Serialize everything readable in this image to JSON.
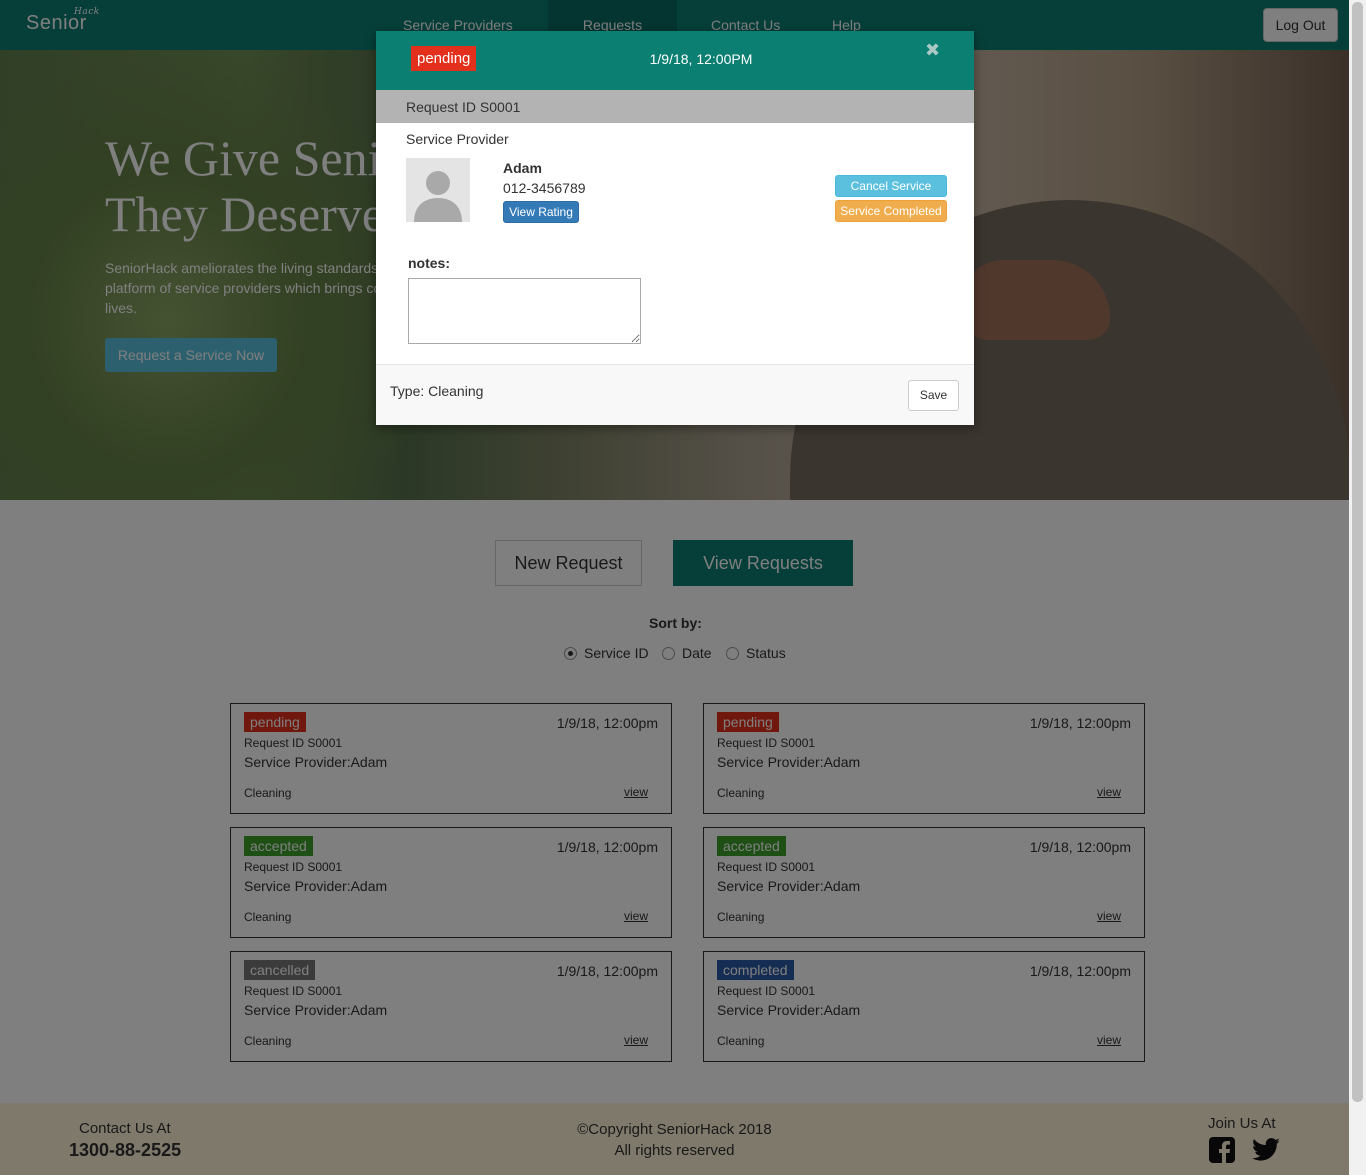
{
  "nav": {
    "logo": "Senior",
    "logo_super": "Hack",
    "links": [
      "Service Providers",
      "Requests",
      "Contact Us",
      "Help"
    ],
    "logout": "Log Out"
  },
  "hero": {
    "title": "We Give Seniors\nThey Deserve",
    "text": "SeniorHack ameliorates the living standards of the elderly by providing a platform of service providers which brings convenience and comfort in their lives.",
    "cta": "Request a Service Now"
  },
  "main": {
    "new_request": "New Request",
    "view_requests": "View Requests",
    "sort_label": "Sort by:",
    "sort_options": [
      "Service ID",
      "Date",
      "Status"
    ],
    "sort_selected": "Service ID"
  },
  "cards": [
    {
      "status": "pending",
      "color": "#e2301c",
      "date": "1/9/18, 12:00pm",
      "request_id": "Request ID S0001",
      "provider": "Service Provider:Adam",
      "type": "Cleaning",
      "link": "view"
    },
    {
      "status": "pending",
      "color": "#e2301c",
      "date": "1/9/18, 12:00pm",
      "request_id": "Request ID S0001",
      "provider": "Service Provider:Adam",
      "type": "Cleaning",
      "link": "view"
    },
    {
      "status": "accepted",
      "color": "#3c9e2a",
      "date": "1/9/18, 12:00pm",
      "request_id": "Request ID S0001",
      "provider": "Service Provider:Adam",
      "type": "Cleaning",
      "link": "view"
    },
    {
      "status": "accepted",
      "color": "#3c9e2a",
      "date": "1/9/18, 12:00pm",
      "request_id": "Request ID S0001",
      "provider": "Service Provider:Adam",
      "type": "Cleaning",
      "link": "view"
    },
    {
      "status": "cancelled",
      "color": "#777777",
      "date": "1/9/18, 12:00pm",
      "request_id": "Request ID S0001",
      "provider": "Service Provider:Adam",
      "type": "Cleaning",
      "link": "view"
    },
    {
      "status": "completed",
      "color": "#2d5aa6",
      "date": "1/9/18, 12:00pm",
      "request_id": "Request ID S0001",
      "provider": "Service Provider:Adam",
      "type": "Cleaning",
      "link": "view"
    }
  ],
  "footer": {
    "contact_label": "Contact Us At",
    "phone": "1300-88-2525",
    "copyright": "©Copyright SeniorHack 2018",
    "rights": "All rights reserved",
    "join": "Join Us At",
    "icons": [
      "facebook-icon",
      "twitter-icon"
    ]
  },
  "modal": {
    "status": "pending",
    "status_color": "#e2301c",
    "date": "1/9/18, 12:00PM",
    "close_icon": "close-icon",
    "request_id": "Request ID S0001",
    "section_title": "Service Provider",
    "provider_name": "Adam",
    "provider_phone": "012-3456789",
    "view_rating": "View Rating",
    "cancel_service": "Cancel Service",
    "service_completed": "Service Completed",
    "notes_label": "notes:",
    "notes_value": "",
    "type": "Type: Cleaning",
    "save": "Save"
  },
  "colors": {
    "brand": "#0c7f73",
    "pending": "#e2301c",
    "accepted": "#3c9e2a",
    "cancelled": "#777777",
    "completed": "#2d5aa6",
    "info": "#5bc0de",
    "warning": "#f0ad4e",
    "primary": "#337ab7"
  }
}
